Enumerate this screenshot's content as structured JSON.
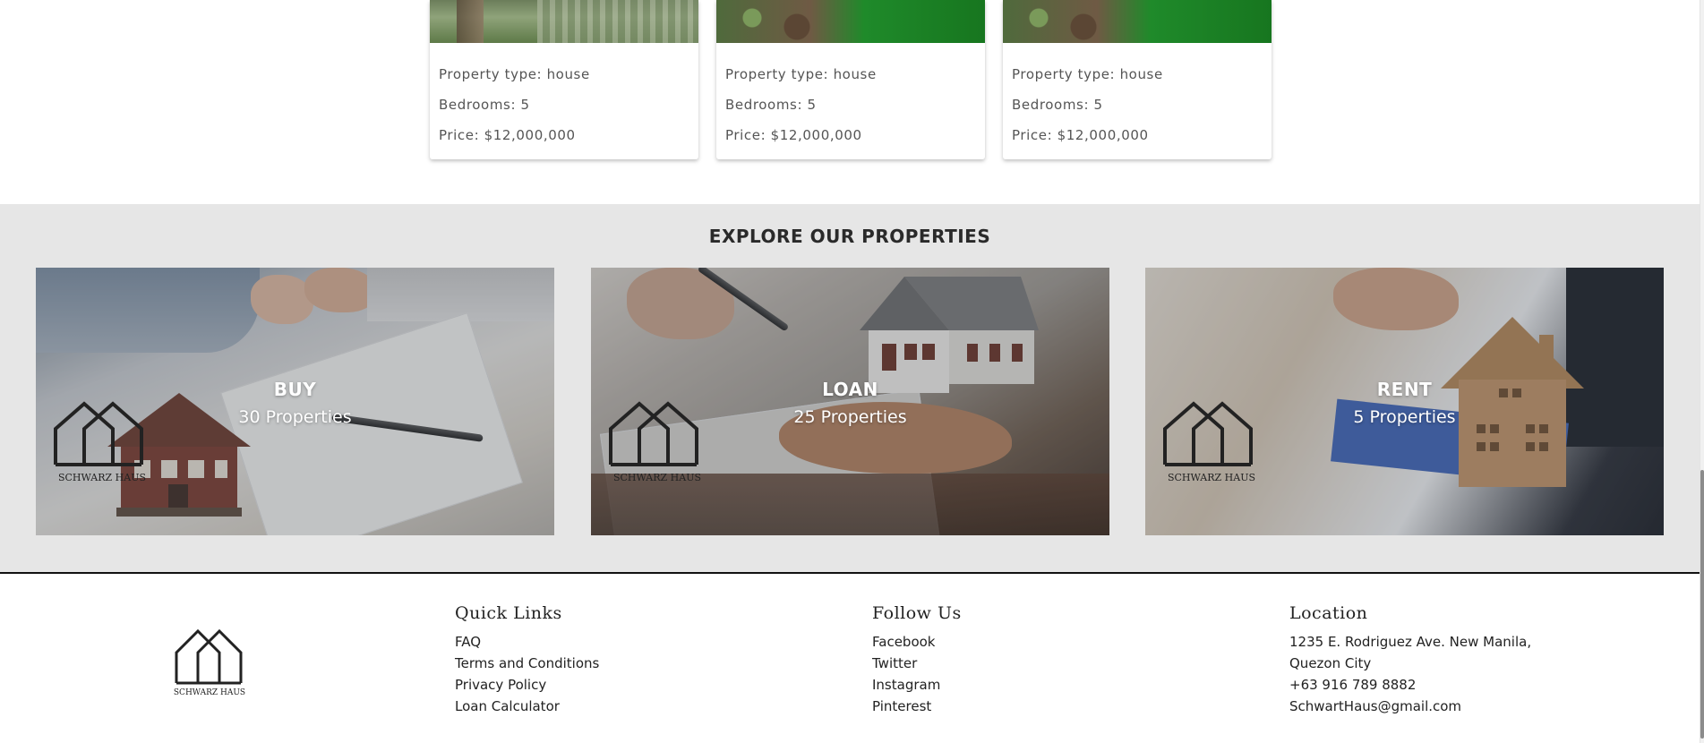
{
  "cards": [
    {
      "image": "garden",
      "type": "Property type: house",
      "bedrooms": "Bedrooms: 5",
      "price": "Price: $12,000,000"
    },
    {
      "image": "lawn",
      "type": "Property type: house",
      "bedrooms": "Bedrooms: 5",
      "price": "Price: $12,000,000"
    },
    {
      "image": "lawn",
      "type": "Property type: house",
      "bedrooms": "Bedrooms: 5",
      "price": "Price: $12,000,000"
    }
  ],
  "explore": {
    "title": "EXPLORE OUR PROPERTIES",
    "tiles": [
      {
        "name": "BUY",
        "count": "30 Properties",
        "logo_text": "SCHWARZ HAUS"
      },
      {
        "name": "LOAN",
        "count": "25 Properties",
        "logo_text": "SCHWARZ HAUS"
      },
      {
        "name": "RENT",
        "count": "5 Properties",
        "logo_text": "SCHWARZ HAUS"
      }
    ]
  },
  "footer": {
    "logo_text": "SCHWARZ HAUS",
    "quick_links": {
      "heading": "Quick Links",
      "items": [
        "FAQ",
        "Terms and Conditions",
        "Privacy Policy",
        "Loan Calculator"
      ]
    },
    "follow_us": {
      "heading": "Follow Us",
      "items": [
        "Facebook",
        "Twitter",
        "Instagram",
        "Pinterest"
      ]
    },
    "location": {
      "heading": "Location",
      "lines": [
        "1235 E. Rodriguez Ave. New Manila,",
        "Quezon City",
        "+63 916 789 8882",
        "SchwartHaus@gmail.com"
      ]
    }
  },
  "colors": {
    "explore_bg": "#e6e6e6",
    "footer_border": "#111111",
    "text_dark": "#222222"
  }
}
